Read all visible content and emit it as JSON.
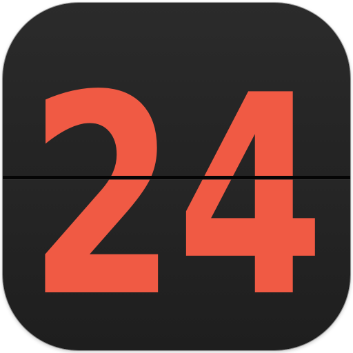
{
  "icon": {
    "label": "24",
    "background_color": "#262626",
    "digit_color": "#f05a44",
    "split_line_color": "#000000"
  }
}
